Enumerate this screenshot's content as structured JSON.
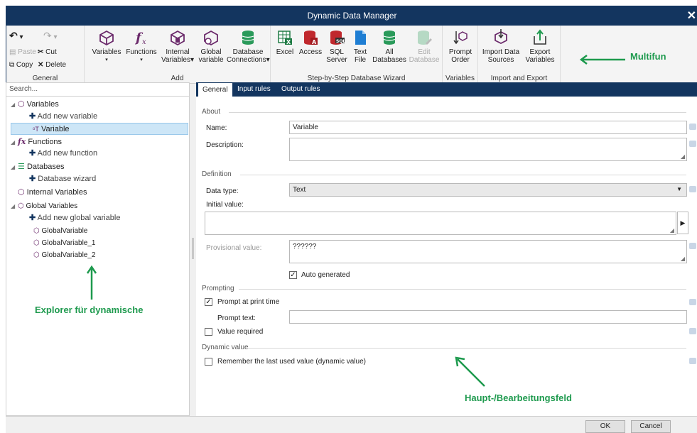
{
  "window": {
    "title": "Dynamic Data Manager",
    "close_glyph": "✕"
  },
  "ribbon": {
    "general": {
      "label": "General",
      "undo": "↶",
      "redo": "↷",
      "paste": "Paste",
      "cut": "Cut",
      "copy": "Copy",
      "delete": "Delete"
    },
    "add": {
      "label": "Add",
      "variables": "Variables",
      "functions": "Functions",
      "internal_variables_1": "Internal",
      "internal_variables_2": "Variables",
      "global_variable_1": "Global",
      "global_variable_2": "variable",
      "database_connections_1": "Database",
      "database_connections_2": "Connections"
    },
    "wizard": {
      "label": "Step-by-Step Database Wizard",
      "excel": "Excel",
      "access": "Access",
      "sql_server_1": "SQL",
      "sql_server_2": "Server",
      "text_file_1": "Text",
      "text_file_2": "File",
      "all_databases_1": "All",
      "all_databases_2": "Databases",
      "edit_database_1": "Edit",
      "edit_database_2": "Database"
    },
    "variables_group": {
      "label": "Variables",
      "prompt_order_1": "Prompt",
      "prompt_order_2": "Order"
    },
    "import_export": {
      "label": "Import and Export",
      "import_1": "Import Data",
      "import_2": "Sources",
      "export_1": "Export",
      "export_2": "Variables"
    }
  },
  "callouts": {
    "ribbon": "Multifun",
    "explorer": "Explorer für dynamische",
    "main": "Haupt-/Bearbeitungsfeld"
  },
  "explorer": {
    "search_placeholder": "Search...",
    "items": [
      {
        "label": "Variables"
      },
      {
        "label": "Add new variable"
      },
      {
        "label": "Variable"
      },
      {
        "label": "Functions"
      },
      {
        "label": "Add new function"
      },
      {
        "label": "Databases"
      },
      {
        "label": "Database wizard"
      },
      {
        "label": "Internal Variables"
      },
      {
        "label": "Global Variables"
      },
      {
        "label": "Add new global variable"
      },
      {
        "label": "GlobalVariable"
      },
      {
        "label": "GlobalVariable_1"
      },
      {
        "label": "GlobalVariable_2"
      }
    ]
  },
  "tabs": [
    {
      "label": "General"
    },
    {
      "label": "Input rules"
    },
    {
      "label": "Output rules"
    }
  ],
  "form": {
    "about": "About",
    "name_label": "Name:",
    "name_value": "Variable",
    "description_label": "Description:",
    "description_value": "",
    "definition": "Definition",
    "data_type_label": "Data type:",
    "data_type_value": "Text",
    "initial_value_label": "Initial value:",
    "initial_value": "",
    "provisional_label": "Provisional value:",
    "provisional_value": "??????",
    "auto_generated": "Auto generated",
    "prompting": "Prompting",
    "prompt_at_print": "Prompt at print time",
    "prompt_text_label": "Prompt text:",
    "prompt_text_value": "",
    "value_required": "Value required",
    "dynamic_value": "Dynamic value",
    "remember_last": "Remember the last used value (dynamic value)"
  },
  "buttons": {
    "ok": "OK",
    "cancel": "Cancel"
  },
  "colors": {
    "titlebar": "#13355f",
    "accent_green": "#1e9a4e",
    "selection": "#cde6f7"
  }
}
